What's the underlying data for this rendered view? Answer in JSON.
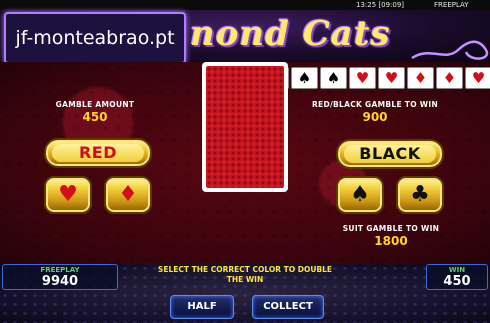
{
  "status": {
    "clock": "13:25 [09:09]",
    "mode": "FREEPLAY"
  },
  "header": {
    "title": "nond Cats",
    "watermark": "jf-monteabrao.pt"
  },
  "history": {
    "cards": [
      {
        "suit": "spade",
        "glyph": "♠",
        "color": "black"
      },
      {
        "suit": "spade",
        "glyph": "♠",
        "color": "black"
      },
      {
        "suit": "spade",
        "glyph": "♠",
        "color": "black"
      },
      {
        "suit": "heart",
        "glyph": "♥",
        "color": "red"
      },
      {
        "suit": "heart",
        "glyph": "♥",
        "color": "red"
      },
      {
        "suit": "diamond",
        "glyph": "♦",
        "color": "red"
      },
      {
        "suit": "diamond",
        "glyph": "♦",
        "color": "red"
      },
      {
        "suit": "heart",
        "glyph": "♥",
        "color": "red"
      }
    ]
  },
  "gamble": {
    "amount_label": "GAMBLE AMOUNT",
    "amount_value": "450",
    "color_label": "RED/BLACK GAMBLE TO WIN",
    "color_value": "900",
    "suit_label": "SUIT GAMBLE TO WIN",
    "suit_value": "1800",
    "red_label": "RED",
    "black_label": "BLACK",
    "heart_glyph": "♥",
    "diamond_glyph": "♦",
    "spade_glyph": "♠",
    "club_glyph": "♣"
  },
  "bottom": {
    "freeplay_label": "FREEPLAY",
    "freeplay_value": "9940",
    "win_label": "WIN",
    "win_value": "450",
    "message_line1": "SELECT THE CORRECT COLOR TO DOUBLE",
    "message_line2": "THE WIN",
    "half_label": "HALF",
    "collect_label": "COLLECT"
  },
  "colors": {
    "gold": "#f3d23e",
    "red": "#d40d1a",
    "accent_green": "#5fd35f",
    "accent_blue": "#3f6bd8"
  }
}
